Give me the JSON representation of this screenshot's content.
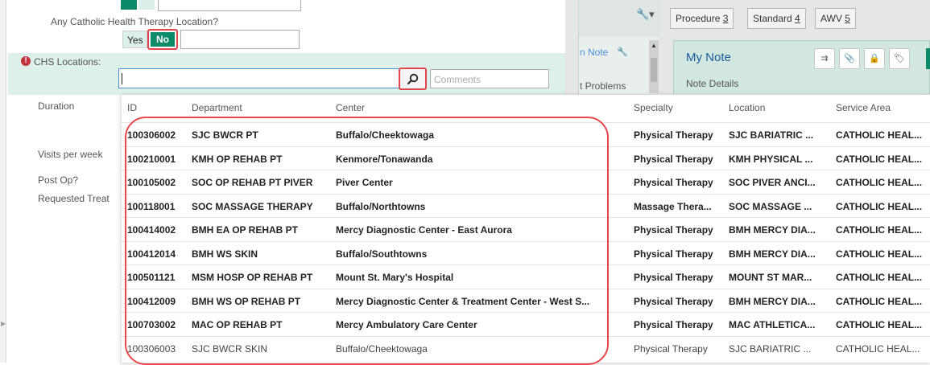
{
  "form": {
    "question_label": "Any Catholic Health Therapy Location?",
    "yes_label": "Yes",
    "no_label": "No",
    "chs_locations_label": "CHS Locations:",
    "chs_alert_glyph": "!",
    "comments_placeholder": "Comments",
    "side_labels": [
      "Duration",
      "Visits per week",
      "Post Op?",
      "Requested Treat"
    ]
  },
  "right_panel": {
    "buttons": [
      {
        "text": "Procedure ",
        "num": "3"
      },
      {
        "text": "Standard ",
        "num": "4"
      },
      {
        "text": "AWV ",
        "num": "5"
      }
    ],
    "note_tab_label": "n Note",
    "problems_label": "t Problems",
    "my_note_title": "My Note",
    "note_details_label": "Note Details"
  },
  "dropdown": {
    "columns": [
      "ID",
      "Department",
      "Center",
      "Specialty",
      "Location",
      "Service Area"
    ],
    "rows": [
      {
        "id": "100306002",
        "department": "SJC BWCR PT",
        "center": "Buffalo/Cheektowaga",
        "specialty": "Physical Therapy",
        "location": "SJC BARIATRIC ...",
        "service_area": "CATHOLIC HEAL...",
        "bold": true
      },
      {
        "id": "100210001",
        "department": "KMH OP REHAB PT",
        "center": "Kenmore/Tonawanda",
        "specialty": "Physical Therapy",
        "location": "KMH PHYSICAL ...",
        "service_area": "CATHOLIC HEAL...",
        "bold": true
      },
      {
        "id": "100105002",
        "department": "SOC OP REHAB PT PIVER",
        "center": "Piver Center",
        "specialty": "Physical Therapy",
        "location": "SOC PIVER ANCI...",
        "service_area": "CATHOLIC HEAL...",
        "bold": true
      },
      {
        "id": "100118001",
        "department": "SOC MASSAGE THERAPY",
        "center": "Buffalo/Northtowns",
        "specialty": "Massage Thera...",
        "location": "SOC MASSAGE ...",
        "service_area": "CATHOLIC HEAL...",
        "bold": true
      },
      {
        "id": "100414002",
        "department": "BMH EA OP REHAB PT",
        "center": "Mercy Diagnostic Center - East Aurora",
        "specialty": "Physical Therapy",
        "location": "BMH MERCY DIA...",
        "service_area": "CATHOLIC HEAL...",
        "bold": true
      },
      {
        "id": "100412014",
        "department": "BMH WS SKIN",
        "center": "Buffalo/Southtowns",
        "specialty": "Physical Therapy",
        "location": "BMH MERCY DIA...",
        "service_area": "CATHOLIC HEAL...",
        "bold": true
      },
      {
        "id": "100501121",
        "department": "MSM HOSP OP REHAB PT",
        "center": "Mount St. Mary's Hospital",
        "specialty": "Physical Therapy",
        "location": "MOUNT ST MAR...",
        "service_area": "CATHOLIC HEAL...",
        "bold": true
      },
      {
        "id": "100412009",
        "department": "BMH WS OP REHAB PT",
        "center": "Mercy Diagnostic Center & Treatment Center - West S...",
        "specialty": "Physical Therapy",
        "location": "BMH MERCY DIA...",
        "service_area": "CATHOLIC HEAL...",
        "bold": true
      },
      {
        "id": "100703002",
        "department": "MAC OP REHAB PT",
        "center": "Mercy Ambulatory Care Center",
        "specialty": "Physical Therapy",
        "location": "MAC ATHLETICA...",
        "service_area": "CATHOLIC HEAL...",
        "bold": true
      },
      {
        "id": "100306003",
        "department": "SJC BWCR SKIN",
        "center": "Buffalo/Cheektowaga",
        "specialty": "Physical Therapy",
        "location": "SJC BARIATRIC ...",
        "service_area": "CATHOLIC HEAL...",
        "bold": false
      }
    ]
  },
  "colors": {
    "accent_green": "#0d8a68",
    "highlight_red": "#e0464b",
    "band_green": "#ddf0ea",
    "link_blue": "#1a5a9c"
  }
}
